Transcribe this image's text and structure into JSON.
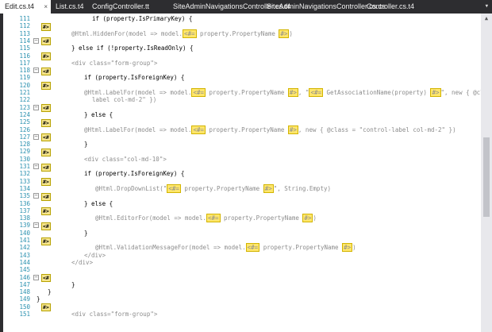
{
  "tabs": [
    {
      "label": "Edit.cs.t4",
      "active": true
    },
    {
      "label": "List.cs.t4",
      "active": false
    },
    {
      "label": "ConfigController.tt",
      "active": false
    },
    {
      "label": "SiteAdminNavigationsController.cs.t4",
      "active": false
    },
    {
      "label": "SiteAdminNavigationsController.cs.cs",
      "active": false
    },
    {
      "label": "Controller.cs.t4",
      "active": false
    }
  ],
  "lines": [
    {
      "n": "111",
      "code": "if (property.IsPrimaryKey) {",
      "style": "normal"
    },
    {
      "n": "112",
      "code": "",
      "style": "normal",
      "marker": "#>"
    },
    {
      "n": "113",
      "code": "@Html.HiddenFor(model => model.<#= property.PropertyName #>)",
      "style": "gray"
    },
    {
      "n": "114",
      "code": "",
      "style": "normal",
      "marker": "<#",
      "fold": true
    },
    {
      "n": "115",
      "code": "} else if (!property.IsReadOnly) {",
      "style": "normal"
    },
    {
      "n": "116",
      "code": "",
      "style": "normal",
      "marker": "#>"
    },
    {
      "n": "117",
      "code": "<div class=\"form-group\">",
      "style": "gray"
    },
    {
      "n": "118",
      "code": "",
      "style": "normal",
      "marker": "<#",
      "fold": true
    },
    {
      "n": "119",
      "code": "if (property.IsForeignKey) {",
      "style": "normal"
    },
    {
      "n": "120",
      "code": "",
      "style": "normal",
      "marker": "#>"
    },
    {
      "n": "121",
      "code": "@Html.LabelFor(model => model.<#= property.PropertyName #>, \"<#= GetAssociationName(property) #>\", new { @class = \"control-",
      "style": "gray"
    },
    {
      "n": "122",
      "code": "label col-md-2\" })",
      "style": "gray"
    },
    {
      "n": "123",
      "code": "",
      "style": "normal",
      "marker": "<#",
      "fold": true
    },
    {
      "n": "124",
      "code": "} else {",
      "style": "normal"
    },
    {
      "n": "125",
      "code": "",
      "style": "normal",
      "marker": "#>"
    },
    {
      "n": "126",
      "code": "@Html.LabelFor(model => model.<#= property.PropertyName #>, new { @class = \"control-label col-md-2\" })",
      "style": "gray"
    },
    {
      "n": "127",
      "code": "",
      "style": "normal",
      "marker": "<#",
      "fold": true
    },
    {
      "n": "128",
      "code": "}",
      "style": "normal"
    },
    {
      "n": "129",
      "code": "",
      "style": "normal",
      "marker": "#>"
    },
    {
      "n": "130",
      "code": "<div class=\"col-md-10\">",
      "style": "gray"
    },
    {
      "n": "131",
      "code": "",
      "style": "normal",
      "marker": "<#",
      "fold": true
    },
    {
      "n": "132",
      "code": "if (property.IsForeignKey) {",
      "style": "normal"
    },
    {
      "n": "133",
      "code": "",
      "style": "normal",
      "marker": "#>"
    },
    {
      "n": "134",
      "code": "@Html.DropDownList(\"<#= property.PropertyName #>\", String.Empty)",
      "style": "gray"
    },
    {
      "n": "135",
      "code": "",
      "style": "normal",
      "marker": "<#",
      "fold": true
    },
    {
      "n": "136",
      "code": "} else {",
      "style": "normal"
    },
    {
      "n": "137",
      "code": "",
      "style": "normal",
      "marker": "#>"
    },
    {
      "n": "138",
      "code": "@Html.EditorFor(model => model.<#= property.PropertyName #>)",
      "style": "gray"
    },
    {
      "n": "139",
      "code": "",
      "style": "normal",
      "marker": "<#",
      "fold": true
    },
    {
      "n": "140",
      "code": "}",
      "style": "normal"
    },
    {
      "n": "141",
      "code": "",
      "style": "normal",
      "marker": "#>"
    },
    {
      "n": "142",
      "code": "@Html.ValidationMessageFor(model => model.<#= property.PropertyName #>)",
      "style": "gray"
    },
    {
      "n": "143",
      "code": "</div>",
      "style": "gray"
    },
    {
      "n": "144",
      "code": "</div>",
      "style": "gray"
    },
    {
      "n": "145",
      "code": "",
      "style": "normal"
    },
    {
      "n": "146",
      "code": "",
      "style": "normal",
      "marker": "<#",
      "fold": true
    },
    {
      "n": "147",
      "code": "}",
      "style": "normal"
    },
    {
      "n": "148",
      "code": "}",
      "style": "normal"
    },
    {
      "n": "149",
      "code": "}",
      "style": "normal"
    },
    {
      "n": "150",
      "code": "",
      "style": "normal",
      "marker": "#>"
    },
    {
      "n": "151",
      "code": "<div class=\"form-group\">",
      "style": "gray"
    }
  ]
}
